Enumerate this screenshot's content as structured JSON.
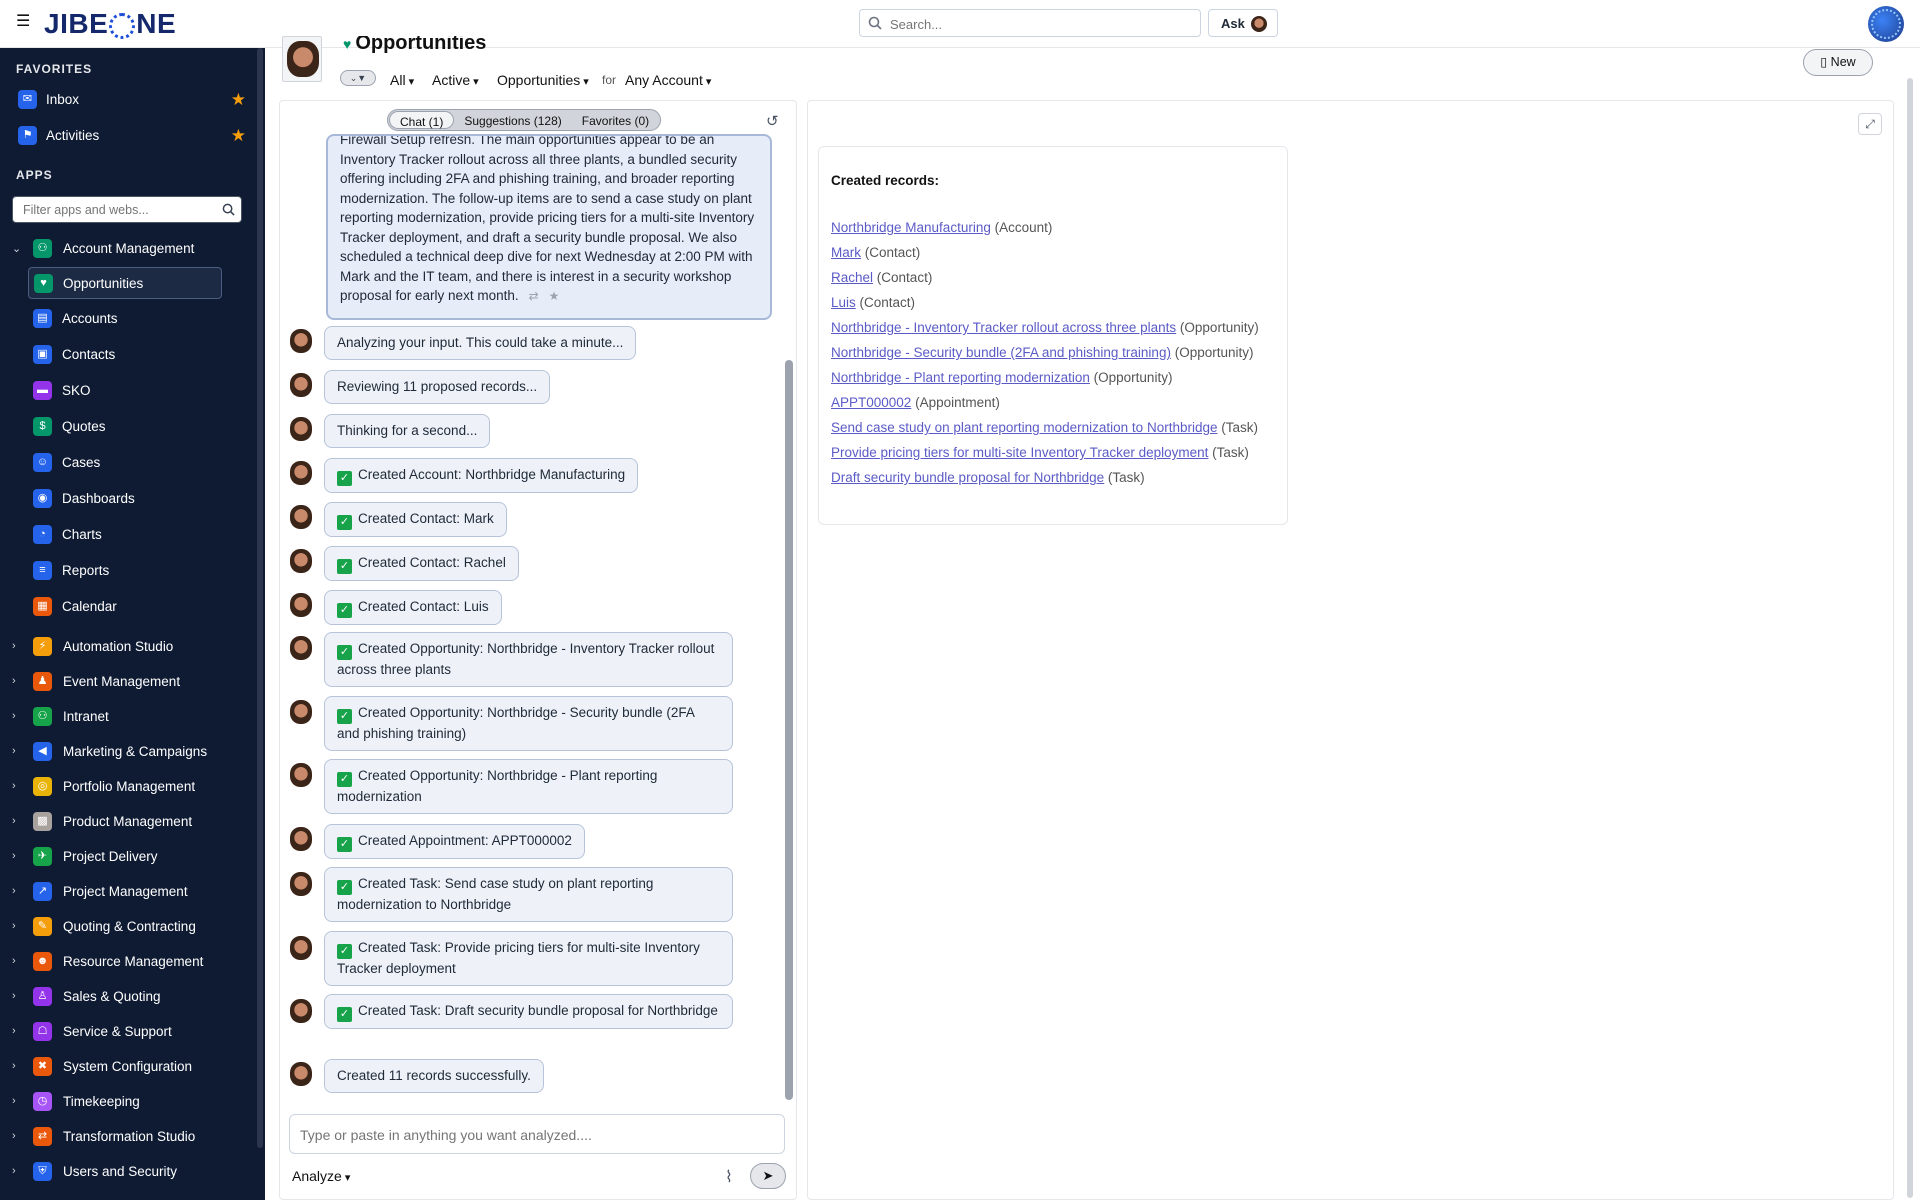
{
  "topbar": {
    "logo": "JIBEONE",
    "search_placeholder": "Search...",
    "ask_label": "Ask"
  },
  "sidebar": {
    "favorites_title": "FAVORITES",
    "favorites": [
      {
        "label": "Inbox",
        "icon": "inbox-icon",
        "color": "#2563eb"
      },
      {
        "label": "Activities",
        "icon": "activities-icon",
        "color": "#2563eb"
      }
    ],
    "apps_title": "APPS",
    "filter_placeholder": "Filter apps and webs...",
    "account_management": {
      "label": "Account Management",
      "items": [
        {
          "label": "Opportunities",
          "color": "#059669",
          "selected": true
        },
        {
          "label": "Accounts",
          "color": "#2563eb"
        },
        {
          "label": "Contacts",
          "color": "#2563eb"
        },
        {
          "label": "SKO",
          "color": "#9333ea"
        },
        {
          "label": "Quotes",
          "color": "#059669"
        },
        {
          "label": "Cases",
          "color": "#2563eb"
        },
        {
          "label": "Dashboards",
          "color": "#2563eb"
        },
        {
          "label": "Charts",
          "color": "#2563eb"
        },
        {
          "label": "Reports",
          "color": "#2563eb"
        },
        {
          "label": "Calendar",
          "color": "#ea580c"
        }
      ]
    },
    "groups": [
      {
        "label": "Automation Studio",
        "color": "#f59e0b"
      },
      {
        "label": "Event Management",
        "color": "#ea580c"
      },
      {
        "label": "Intranet",
        "color": "#16a34a"
      },
      {
        "label": "Marketing & Campaigns",
        "color": "#2563eb"
      },
      {
        "label": "Portfolio Management",
        "color": "#eab308"
      },
      {
        "label": "Product Management",
        "color": "#a8a29e"
      },
      {
        "label": "Project Delivery",
        "color": "#16a34a"
      },
      {
        "label": "Project Management",
        "color": "#2563eb"
      },
      {
        "label": "Quoting & Contracting",
        "color": "#f59e0b"
      },
      {
        "label": "Resource Management",
        "color": "#ea580c"
      },
      {
        "label": "Sales & Quoting",
        "color": "#9333ea"
      },
      {
        "label": "Service & Support",
        "color": "#9333ea"
      },
      {
        "label": "System Configuration",
        "color": "#ea580c"
      },
      {
        "label": "Timekeeping",
        "color": "#a855f7"
      },
      {
        "label": "Transformation Studio",
        "color": "#ea580c"
      },
      {
        "label": "Users and Security",
        "color": "#2563eb"
      }
    ]
  },
  "header": {
    "title": "Opportunities",
    "filter_all": "All",
    "filter_active": "Active",
    "filter_type": "Opportunities",
    "for_label": "for",
    "filter_account": "Any Account",
    "new_label": "New"
  },
  "chat": {
    "tabs": [
      "Chat (1)",
      "Suggestions (128)",
      "Favorites (0)"
    ],
    "summary": "Firewall Setup refresh. The main opportunities appear to be an Inventory Tracker rollout across all three plants, a bundled security offering including 2FA and phishing training, and broader reporting modernization. The follow-up items are to send a case study on plant reporting modernization, provide pricing tiers for a multi-site Inventory Tracker deployment, and draft a security bundle proposal. We also scheduled a technical deep dive for next Wednesday at 2:00 PM with Mark and the IT team, and there is interest in a security workshop proposal for early next month.",
    "messages": [
      {
        "text": "Analyzing your input. This could take a minute...",
        "check": false
      },
      {
        "text": "Reviewing 11 proposed records...",
        "check": false
      },
      {
        "text": "Thinking for a second...",
        "check": false
      },
      {
        "text": "Created Account: Northbridge Manufacturing",
        "check": true
      },
      {
        "text": "Created Contact: Mark",
        "check": true
      },
      {
        "text": "Created Contact: Rachel",
        "check": true
      },
      {
        "text": "Created Contact: Luis",
        "check": true
      },
      {
        "text": "Created Opportunity: Northbridge - Inventory Tracker rollout across three plants",
        "check": true
      },
      {
        "text": "Created Opportunity: Northbridge - Security bundle (2FA and phishing training)",
        "check": true
      },
      {
        "text": "Created Opportunity: Northbridge - Plant reporting modernization",
        "check": true
      },
      {
        "text": "Created Appointment: APPT000002",
        "check": true
      },
      {
        "text": "Created Task: Send case study on plant reporting modernization to Northbridge",
        "check": true
      },
      {
        "text": "Created Task: Provide pricing tiers for multi-site Inventory Tracker deployment",
        "check": true
      },
      {
        "text": "Created Task: Draft security bundle proposal for Northbridge",
        "check": true
      },
      {
        "text": "Created 11 records successfully.",
        "check": false
      }
    ],
    "input_placeholder": "Type or paste in anything you want analyzed....",
    "analyze_label": "Analyze"
  },
  "records": {
    "title": "Created records:",
    "items": [
      {
        "name": "Northbridge Manufacturing",
        "type": "(Account)"
      },
      {
        "name": "Mark",
        "type": "(Contact)"
      },
      {
        "name": "Rachel",
        "type": "(Contact)"
      },
      {
        "name": "Luis",
        "type": "(Contact)"
      },
      {
        "name": "Northbridge - Inventory Tracker rollout across three plants",
        "type": "(Opportunity)"
      },
      {
        "name": "Northbridge - Security bundle (2FA and phishing training)",
        "type": "(Opportunity)"
      },
      {
        "name": "Northbridge - Plant reporting modernization",
        "type": "(Opportunity)"
      },
      {
        "name": "APPT000002",
        "type": "(Appointment)"
      },
      {
        "name": "Send case study on plant reporting modernization to Northbridge",
        "type": "(Task)"
      },
      {
        "name": "Provide pricing tiers for multi-site Inventory Tracker deployment",
        "type": "(Task)"
      },
      {
        "name": "Draft security bundle proposal for Northbridge",
        "type": "(Task)"
      }
    ]
  }
}
